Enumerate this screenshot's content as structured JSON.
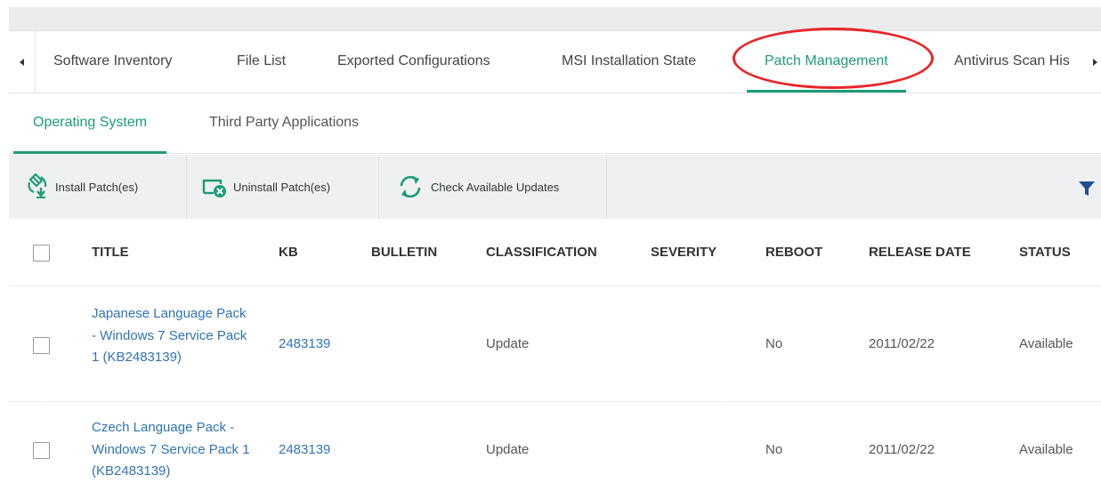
{
  "main_tabs": [
    {
      "label": "Software Inventory"
    },
    {
      "label": "File List"
    },
    {
      "label": "Exported Configurations"
    },
    {
      "label": "MSI Installation State"
    },
    {
      "label": "Patch Management"
    },
    {
      "label": "Antivirus Scan His"
    }
  ],
  "active_main_tab": "Patch Management",
  "sub_tabs": [
    {
      "label": "Operating System"
    },
    {
      "label": "Third Party Applications"
    }
  ],
  "active_sub_tab": "Operating System",
  "toolbar": {
    "install_label": "Install Patch(es)",
    "uninstall_label": "Uninstall Patch(es)",
    "check_label": "Check Available Updates"
  },
  "table": {
    "columns": [
      "TITLE",
      "KB",
      "BULLETIN",
      "CLASSIFICATION",
      "SEVERITY",
      "REBOOT",
      "RELEASE DATE",
      "STATUS"
    ],
    "rows": [
      {
        "title": "Japanese Language Pack - Windows 7 Service Pack 1 (KB2483139)",
        "kb": "2483139",
        "bulletin": "",
        "classification": "Update",
        "severity": "",
        "reboot": "No",
        "release_date": "2011/02/22",
        "status": "Available"
      },
      {
        "title": "Czech Language Pack - Windows 7 Service Pack 1 (KB2483139)",
        "kb": "2483139",
        "bulletin": "",
        "classification": "Update",
        "severity": "",
        "reboot": "No",
        "release_date": "2011/02/22",
        "status": "Available"
      }
    ]
  },
  "colors": {
    "accent": "#1e9b78",
    "link": "#2f74b5",
    "highlight": "#e8262a",
    "toolbar_bg": "#eef0f1"
  },
  "icons": [
    "chevron-left-icon",
    "chevron-right-icon",
    "install-patch-icon",
    "uninstall-patch-icon",
    "refresh-icon",
    "filter-icon"
  ]
}
